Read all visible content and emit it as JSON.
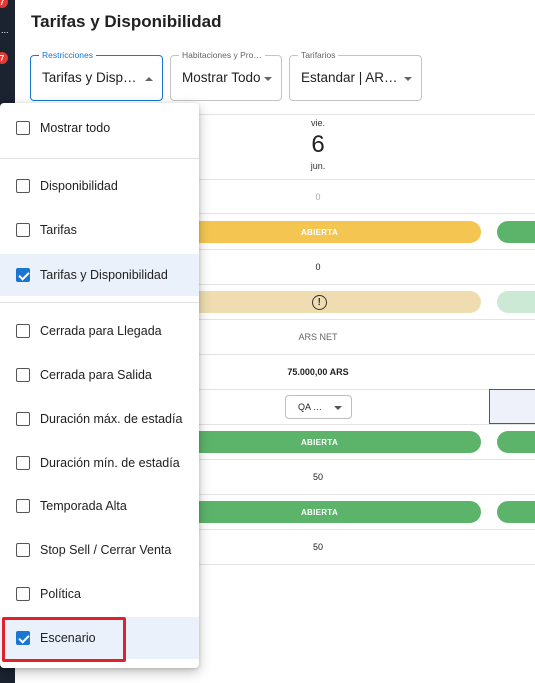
{
  "sidebar": {
    "badge_1": "7",
    "badge_2": "7",
    "overflow": "..."
  },
  "page_title": "Tarifas y Disponibilidad",
  "filters": {
    "restricciones": {
      "label": "Restricciones",
      "value": "Tarifas y Disp…"
    },
    "habitaciones": {
      "label": "Habitaciones y Pro…",
      "value": "Mostrar Todo"
    },
    "tarifarios": {
      "label": "Tarifarios",
      "value": "Estandar | AR…"
    }
  },
  "date": {
    "weekday": "vie.",
    "day": "6",
    "month": "jun."
  },
  "grid": {
    "row1_value": "0",
    "row2_status": "ABIERTA",
    "row3_value": "0",
    "row5_label": "ARS NET",
    "row6_price": "75.000,00 ARS",
    "row7_select": "QA …",
    "row8_status": "ABIERTA",
    "row9_value": "50",
    "row10_status": "ABIERTA",
    "row11_value": "50"
  },
  "menu": {
    "items": [
      {
        "label": "Mostrar todo",
        "checked": false
      },
      {
        "label": "Disponibilidad",
        "checked": false
      },
      {
        "label": "Tarifas",
        "checked": false
      },
      {
        "label": "Tarifas y Disponibilidad",
        "checked": true
      },
      {
        "label": "Cerrada para Llegada",
        "checked": false
      },
      {
        "label": "Cerrada para Salida",
        "checked": false
      },
      {
        "label": "Duración máx. de estadía",
        "checked": false
      },
      {
        "label": "Duración mín. de estadía",
        "checked": false
      },
      {
        "label": "Temporada Alta",
        "checked": false
      },
      {
        "label": "Stop Sell / Cerrar Venta",
        "checked": false
      },
      {
        "label": "Política",
        "checked": false
      },
      {
        "label": "Escenario",
        "checked": true
      }
    ]
  },
  "colors": {
    "accent": "#1976d2",
    "open_yellow": "#f4c651",
    "open_green": "#5cb46b",
    "highlight_red": "#e0202a"
  }
}
